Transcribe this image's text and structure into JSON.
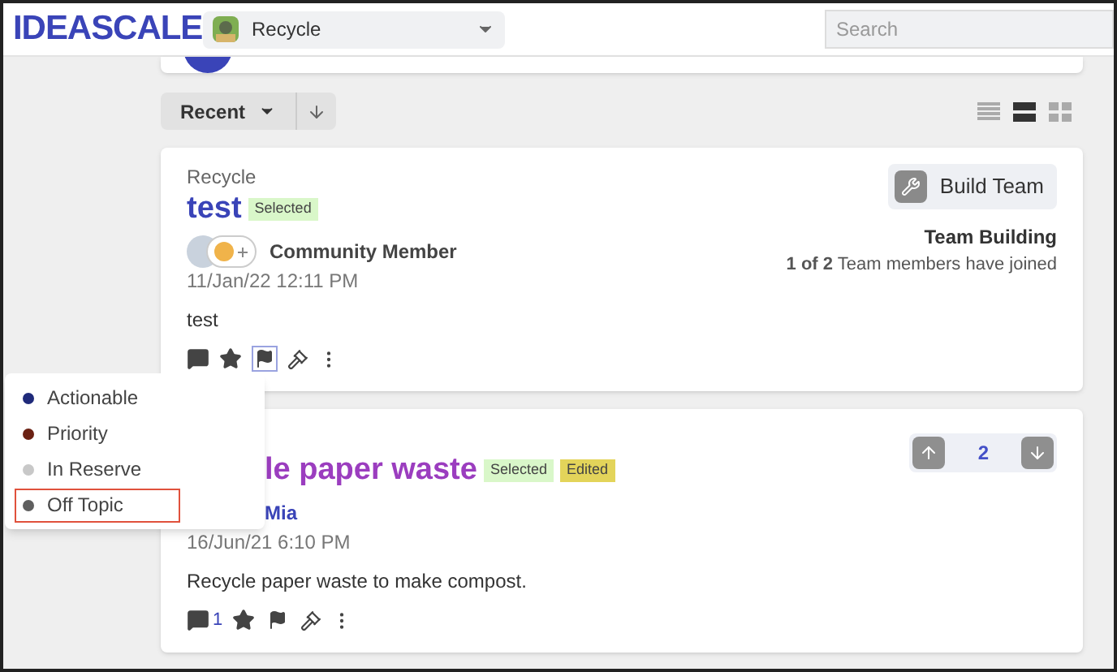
{
  "header": {
    "logo": "IDEASCALE",
    "community": "Recycle",
    "search": {
      "placeholder": "Search"
    }
  },
  "toolbar": {
    "sort": "Recent",
    "views": [
      {
        "kind": "list",
        "selected": false
      },
      {
        "kind": "rows",
        "selected": true
      },
      {
        "kind": "grid",
        "selected": false
      }
    ]
  },
  "ideas": [
    {
      "campaign": "Recycle",
      "title": "test",
      "visited": false,
      "tags": [
        {
          "label": "Selected",
          "color": "#d9f7c9"
        }
      ],
      "avatar": true,
      "author": "Community Member",
      "author_is_link": false,
      "date": "11/Jan/22 12:11 PM",
      "body": "test",
      "flag_open": true,
      "side": {
        "kind": "team",
        "button": "Build Team",
        "heading": "Team Building",
        "text": "**1 of 2** Team members have joined"
      }
    },
    {
      "title": "le paper waste",
      "visited": true,
      "tags": [
        {
          "label": "Selected",
          "color": "#d9f7c9"
        },
        {
          "label": "Edited",
          "color": "#e3d45a"
        }
      ],
      "avatar": false,
      "author": "Mia",
      "author_is_link": true,
      "date": "16/Jun/21 6:10 PM",
      "body": "Recycle paper waste to make compost.",
      "comments": "1",
      "flag_open": false,
      "side": {
        "kind": "vote",
        "count": "2"
      }
    }
  ],
  "flag_menu": [
    {
      "label": "Actionable",
      "color": "#1f2a7a",
      "selected": false
    },
    {
      "label": "Priority",
      "color": "#6b2113",
      "selected": false
    },
    {
      "label": "In Reserve",
      "color": "#c8c8c8",
      "selected": false
    },
    {
      "label": "Off Topic",
      "color": "#5f5f5f",
      "selected": true
    }
  ]
}
